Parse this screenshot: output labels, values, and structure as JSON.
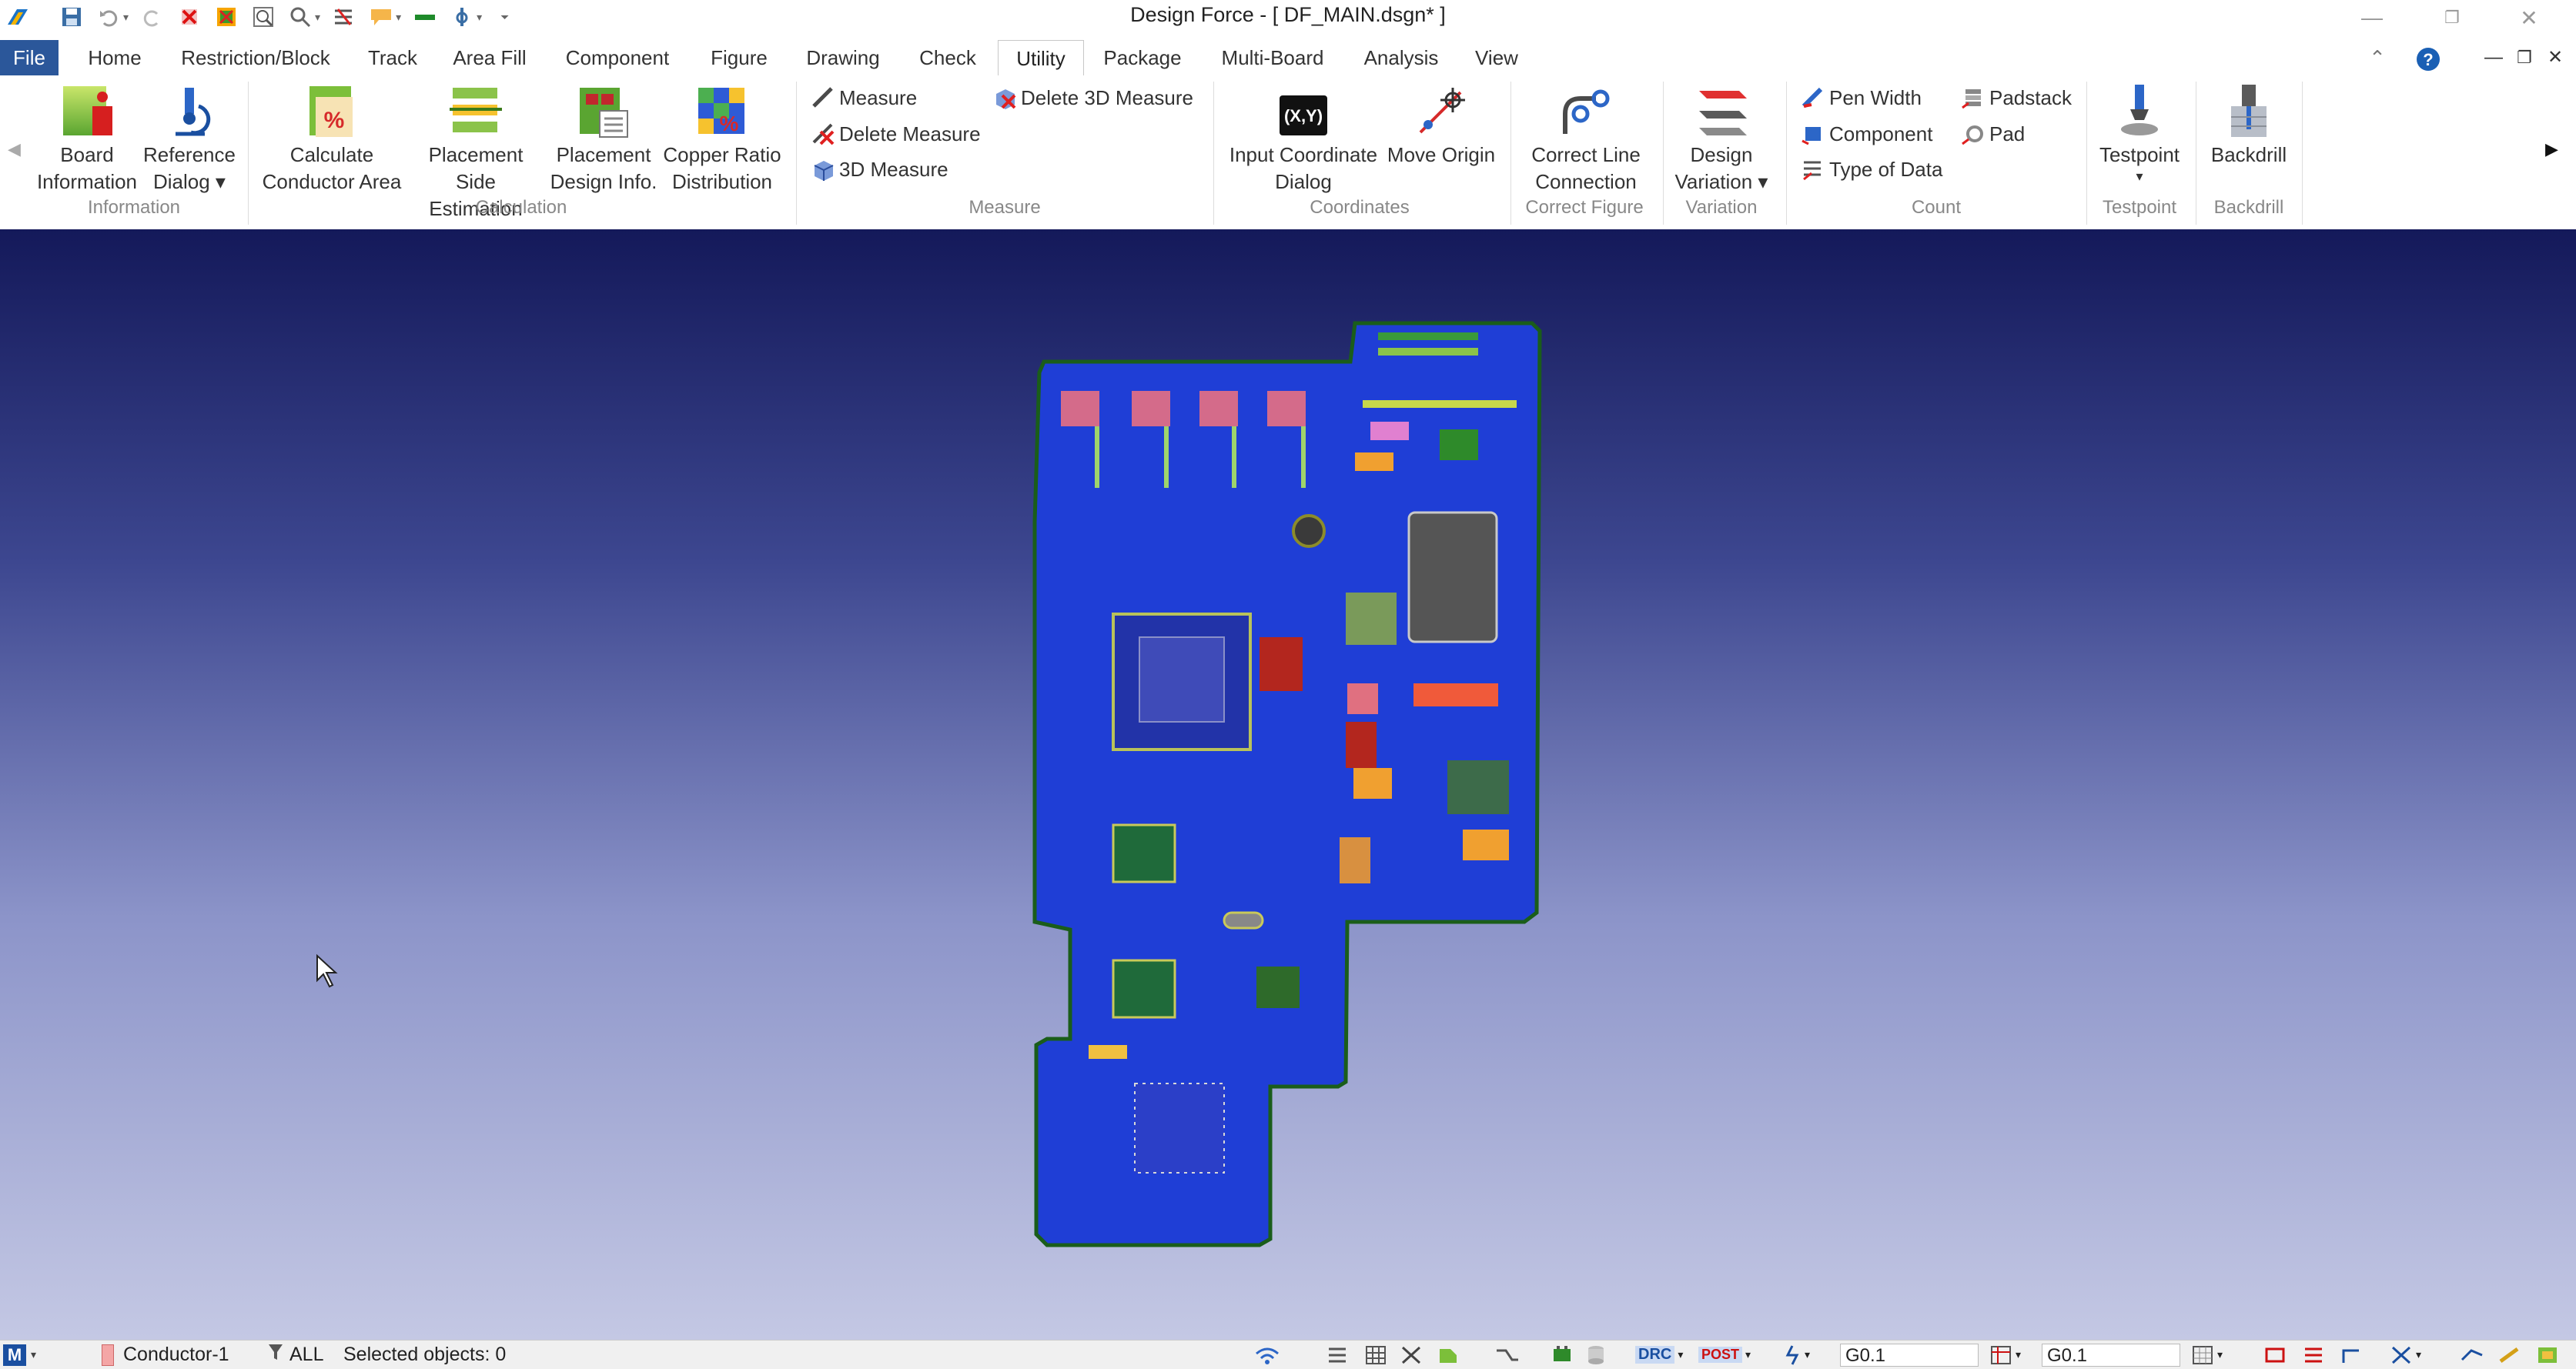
{
  "window": {
    "title": "Design Force - [ DF_MAIN.dsgn* ]"
  },
  "tabs": [
    {
      "label": "File"
    },
    {
      "label": "Home"
    },
    {
      "label": "Restriction/Block"
    },
    {
      "label": "Track"
    },
    {
      "label": "Area Fill"
    },
    {
      "label": "Component"
    },
    {
      "label": "Figure"
    },
    {
      "label": "Drawing"
    },
    {
      "label": "Check"
    },
    {
      "label": "Utility",
      "active": true
    },
    {
      "label": "Package"
    },
    {
      "label": "Multi-Board"
    },
    {
      "label": "Analysis"
    },
    {
      "label": "View"
    }
  ],
  "ribbon": {
    "information": {
      "group_label": "Information",
      "board_information": {
        "line1": "Board",
        "line2": "Information"
      },
      "reference_dialog": {
        "line1": "Reference",
        "line2": "Dialog ▾"
      }
    },
    "calculation": {
      "group_label": "Calculation",
      "calculate_conductor_area": {
        "line1": "Calculate",
        "line2": "Conductor Area"
      },
      "placement_side_estimation": {
        "line1": "Placement Side",
        "line2": "Estimation"
      },
      "placement_design_info": {
        "line1": "Placement",
        "line2": "Design Info."
      },
      "copper_ratio_distribution": {
        "line1": "Copper Ratio",
        "line2": "Distribution"
      }
    },
    "measure": {
      "group_label": "Measure",
      "measure": "Measure",
      "delete_measure": "Delete Measure",
      "measure_3d": "3D Measure",
      "delete_3d_measure": "Delete 3D Measure"
    },
    "coordinates": {
      "group_label": "Coordinates",
      "input_coordinate_dialog": {
        "line1": "Input Coordinate",
        "line2": "Dialog"
      },
      "move_origin": "Move Origin",
      "xy_icon_text": "(X,Y)"
    },
    "correct_figure": {
      "group_label": "Correct Figure",
      "correct_line_connection": {
        "line1": "Correct Line",
        "line2": "Connection"
      }
    },
    "variation": {
      "group_label": "Variation",
      "design_variation": {
        "line1": "Design",
        "line2": "Variation ▾"
      }
    },
    "count": {
      "group_label": "Count",
      "pen_width": "Pen Width",
      "component": "Component",
      "type_of_data": "Type of Data",
      "padstack": "Padstack",
      "pad": "Pad"
    },
    "testpoint": {
      "group_label": "Testpoint",
      "testpoint": "Testpoint"
    },
    "backdrill": {
      "group_label": "Backdrill",
      "backdrill": "Backdrill"
    }
  },
  "statusbar": {
    "mode": "M",
    "layer": "Conductor-1",
    "filter": "ALL",
    "selected": "Selected objects: 0",
    "drc": "DRC",
    "post": "POST",
    "grid1": "G0.1",
    "grid2": "G0.1"
  },
  "colors": {
    "file_tab": "#2b579a",
    "board_fill": "#1f3ed6",
    "board_outline": "#1a5d1a",
    "canvas_top": "#14195a",
    "canvas_bottom": "#c4c8e4"
  }
}
